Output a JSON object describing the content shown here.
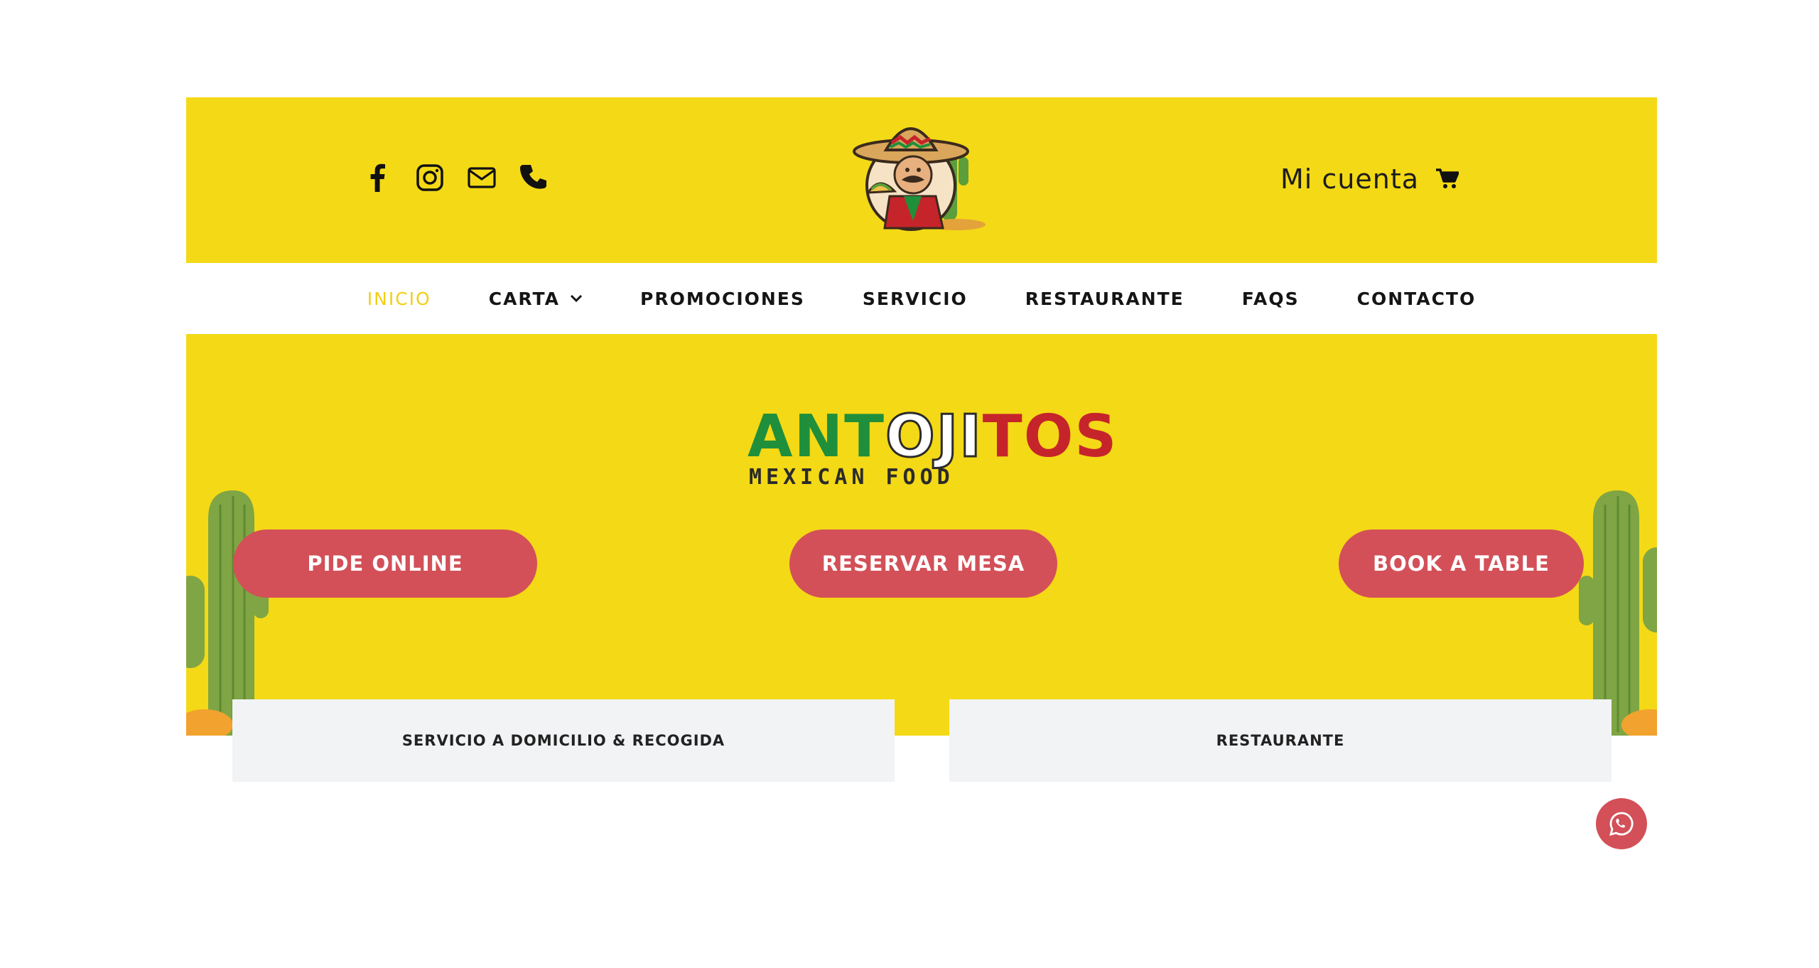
{
  "topbar": {
    "social": [
      {
        "icon": "facebook-icon"
      },
      {
        "icon": "instagram-icon"
      },
      {
        "icon": "mail-icon"
      },
      {
        "icon": "phone-icon"
      }
    ],
    "account_label": "Mi cuenta",
    "cart_icon": "cart-icon"
  },
  "nav": {
    "items": [
      {
        "label": "INICIO",
        "active": true
      },
      {
        "label": "CARTA",
        "dropdown": true
      },
      {
        "label": "PROMOCIONES"
      },
      {
        "label": "SERVICIO"
      },
      {
        "label": "RESTAURANTE"
      },
      {
        "label": "FAQS"
      },
      {
        "label": "CONTACTO"
      }
    ]
  },
  "hero": {
    "logo": {
      "part1": "ANT",
      "part2": "OJI",
      "part3": "TOS",
      "subtitle": "MEXICAN FOOD"
    },
    "buttons": {
      "pide_online": "PIDE ONLINE",
      "reservar_mesa": "RESERVAR MESA",
      "book_table": "BOOK A TABLE"
    }
  },
  "cards": {
    "domicilio": "SERVICIO A DOMICILIO & RECOGIDA",
    "restaurante": "RESTAURANTE"
  },
  "colors": {
    "yellow": "#f4d916",
    "button_red": "#d35058",
    "active_nav": "#f2cf15",
    "card_bg": "#f2f3f5"
  }
}
